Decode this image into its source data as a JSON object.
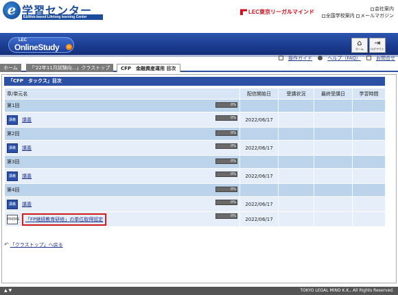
{
  "header": {
    "logo_letter": "e",
    "title": "学習センター",
    "subtitle": "E&Web-based Lifelong learning Center",
    "brand": "LEC東京リーガルマインド",
    "links": [
      "会社案内",
      "全国学校案内",
      "メールマガジン"
    ]
  },
  "banner": {
    "lec": "LEC",
    "product": "OnlineStudy",
    "sp": "SP",
    "home_label": "ホーム",
    "logout_label": "ログアウト"
  },
  "guides": [
    "操作ガイド",
    "ヘルプ（FAQ）",
    "お問合せ"
  ],
  "breadcrumb": [
    "ホーム",
    "「'22年11月試験向...」クラストップ",
    "CFP　金融資産運用 目次"
  ],
  "section_title": "「CFP　タックス」目次",
  "table": {
    "headers": [
      "章/単元名",
      "配信開始日",
      "受講状況",
      "最終受講日",
      "学習時間"
    ],
    "rows": [
      {
        "type": "chapter",
        "label": "第1回",
        "progress": "0%"
      },
      {
        "type": "item",
        "badge": "講義",
        "label": "講義",
        "progress": "0%",
        "date": "2022/06/17"
      },
      {
        "type": "chapter",
        "label": "第2回",
        "progress": "0%"
      },
      {
        "type": "item",
        "badge": "講義",
        "label": "講義",
        "progress": "0%",
        "date": "2022/06/17"
      },
      {
        "type": "chapter",
        "label": "第3回",
        "progress": "0%"
      },
      {
        "type": "item",
        "badge": "講義",
        "label": "講義",
        "progress": "0%",
        "date": "2022/06/17"
      },
      {
        "type": "chapter",
        "label": "第4回",
        "progress": "0%"
      },
      {
        "type": "item",
        "badge": "講義",
        "label": "講義",
        "progress": "0%",
        "date": "2022/06/17"
      },
      {
        "type": "item",
        "badge": "PREMS",
        "label": "「FP継続教育研修」の単位取得認定",
        "progress": "0%",
        "date": "2022/06/17",
        "highlight": true
      }
    ]
  },
  "back_link": "「クラストップ」へ戻る",
  "footer": {
    "arrows": "▲ ▼",
    "copyright": "TOKYO LEGAL MIND K.K., All Rights Reserved."
  },
  "colors": {
    "brand_blue": "#2c50a3",
    "lec_red": "#d0101b",
    "highlight_red": "#d01c1c"
  }
}
